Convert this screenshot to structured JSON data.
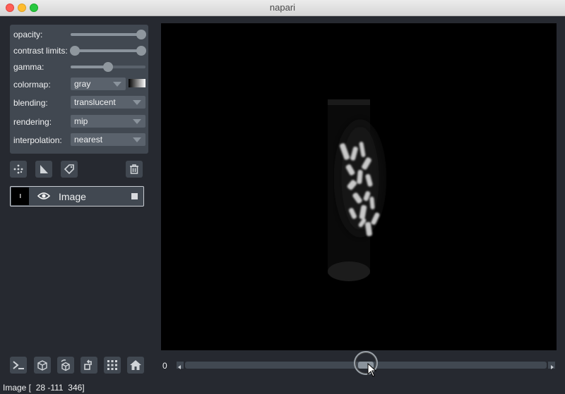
{
  "window": {
    "title": "napari"
  },
  "layer_controls": {
    "opacity_label": "opacity:",
    "opacity_value": 1.0,
    "contrast_limits_label": "contrast limits:",
    "contrast_limits_value": [
      0.0,
      1.0
    ],
    "gamma_label": "gamma:",
    "gamma_value": 0.5,
    "colormap_label": "colormap:",
    "colormap_value": "gray",
    "blending_label": "blending:",
    "blending_value": "translucent",
    "rendering_label": "rendering:",
    "rendering_value": "mip",
    "interpolation_label": "interpolation:",
    "interpolation_value": "nearest"
  },
  "layer_buttons": [
    "new-points-icon",
    "new-shapes-icon",
    "new-labels-icon",
    "delete-layer-icon"
  ],
  "layers": [
    {
      "name": "Image",
      "visible": true
    }
  ],
  "dims": {
    "index_label": "0",
    "slider_fraction": 0.5
  },
  "viewer_buttons": [
    "console-icon",
    "ndisplay-3d-icon",
    "roll-dims-icon",
    "transpose-dims-icon",
    "grid-icon",
    "home-icon"
  ],
  "status": {
    "text": "Image [  28 -111  346]"
  },
  "colors": {
    "background": "#262930",
    "panel": "#414851",
    "canvas": "#000000"
  }
}
